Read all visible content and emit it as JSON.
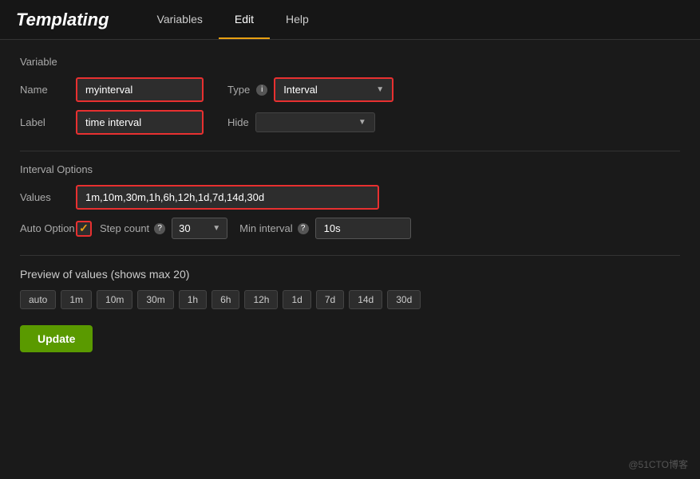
{
  "header": {
    "title": "Templating",
    "tabs": [
      {
        "label": "Variables",
        "active": false
      },
      {
        "label": "Edit",
        "active": true
      },
      {
        "label": "Help",
        "active": false
      }
    ]
  },
  "variable_section": {
    "section_label": "Variable",
    "name_label": "Name",
    "name_value": "myinterval",
    "type_label": "Type",
    "type_info_icon": "i",
    "type_value": "Interval",
    "label_label": "Label",
    "label_value": "time interval",
    "hide_label": "Hide",
    "hide_value": ""
  },
  "interval_section": {
    "section_label": "Interval Options",
    "values_label": "Values",
    "values_value": "1m,10m,30m,1h,6h,12h,1d,7d,14d,30d",
    "auto_option_label": "Auto Option",
    "step_count_label": "Step count",
    "step_info_icon": "?",
    "step_value": "30",
    "min_interval_label": "Min interval",
    "min_interval_info_icon": "?",
    "min_interval_value": "10s"
  },
  "preview_section": {
    "title": "Preview of values (shows max 20)",
    "tags": [
      "auto",
      "1m",
      "10m",
      "30m",
      "1h",
      "6h",
      "12h",
      "1d",
      "7d",
      "14d",
      "30d"
    ]
  },
  "update_button": {
    "label": "Update"
  },
  "watermark": "@51CTO博客"
}
